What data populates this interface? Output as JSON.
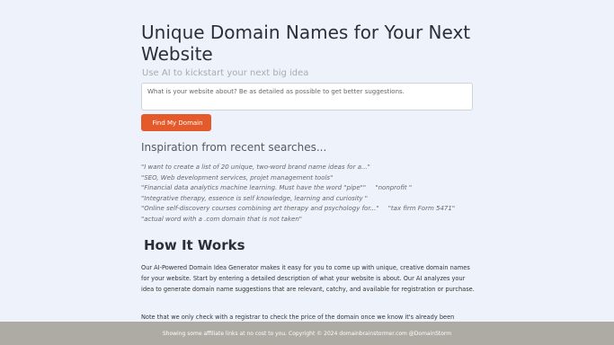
{
  "header": {
    "title": "Unique Domain Names for Your Next Website",
    "subtitle": "Use AI to kickstart your next big idea"
  },
  "search": {
    "placeholder": "What is your website about? Be as detailed as possible to get better suggestions."
  },
  "find_button": {
    "icon": "",
    "label": "Find My Domain"
  },
  "inspiration": {
    "title": "Inspiration from recent searches...",
    "lines": [
      [
        "\"I want to create a list of 20 unique, two-word brand name ideas for a...\""
      ],
      [
        "\"SEO, Web development services, projet management tools\""
      ],
      [
        "\"Financial data analytics machine learning. Must have the word \"pipe\"\"",
        "\"nonprofit \""
      ],
      [
        "\"Integrative therapy, essence is self knowledge, learning and curiosity \""
      ],
      [
        "\"Online self-discovery courses combining art therapy and psychology for...\"",
        "\"tax firm Form 5471\""
      ],
      [
        "\"actual word with a .com domain that is not taken\""
      ]
    ]
  },
  "how": {
    "icon": "",
    "title": "How It Works",
    "paragraph1": "Our AI-Powered Domain Idea Generator makes it easy for you to come up with unique, creative domain names for your website. Start by entering a detailed description of what your website is about. Our AI analyzes your idea to generate domain name suggestions that are relevant, catchy, and available for registration or purchase.",
    "paragraph2": "Note that we only check with a registrar to check the price of the domain once we know it's already been"
  },
  "footer": {
    "text": "Showing some affiliate links at no cost to you. Copyright © 2024 domainbrainstormer.com @DomainStorm"
  }
}
